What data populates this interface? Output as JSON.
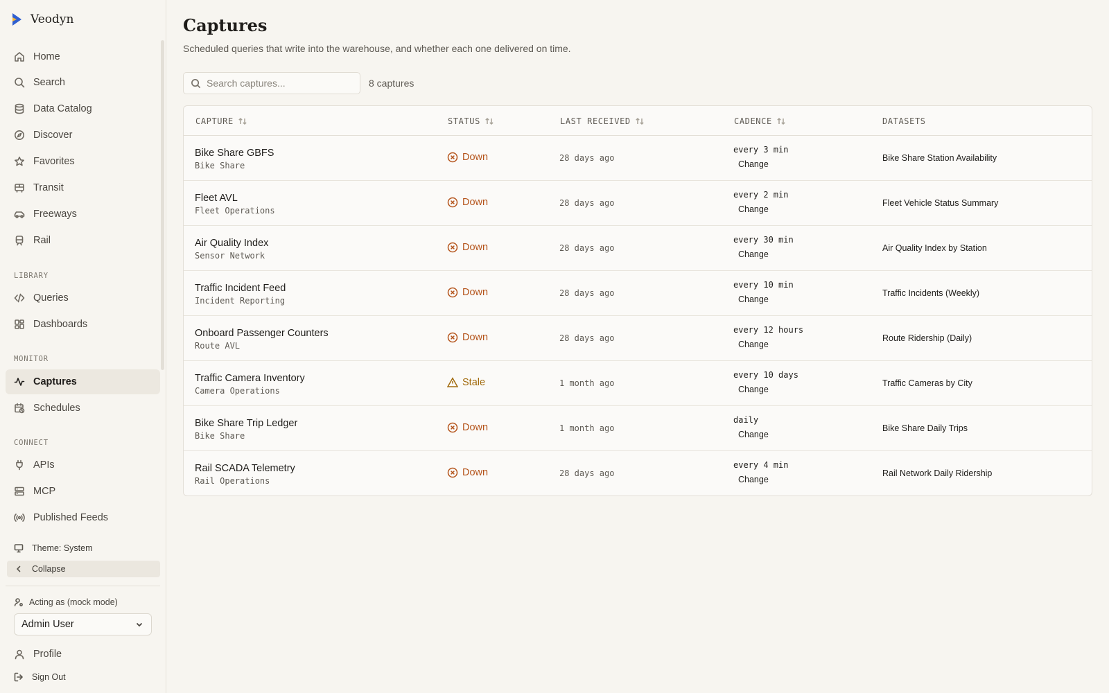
{
  "app": {
    "name": "Veodyn"
  },
  "colors": {
    "accent_blue": "#2f5fd0",
    "accent_yellow": "#f2b33a",
    "down": "#b4531a",
    "stale": "#a16a0c",
    "background": "#f7f5f0"
  },
  "sidebar": {
    "main_items": [
      {
        "label": "Home",
        "icon": "home-icon"
      },
      {
        "label": "Search",
        "icon": "search-icon"
      },
      {
        "label": "Data Catalog",
        "icon": "database-icon"
      },
      {
        "label": "Discover",
        "icon": "compass-icon"
      },
      {
        "label": "Favorites",
        "icon": "star-icon"
      },
      {
        "label": "Transit",
        "icon": "bus-icon"
      },
      {
        "label": "Freeways",
        "icon": "car-icon"
      },
      {
        "label": "Rail",
        "icon": "train-icon"
      }
    ],
    "library_label": "LIBRARY",
    "library_items": [
      {
        "label": "Queries",
        "icon": "code-icon"
      },
      {
        "label": "Dashboards",
        "icon": "dashboard-icon"
      }
    ],
    "monitor_label": "MONITOR",
    "monitor_items": [
      {
        "label": "Captures",
        "icon": "activity-icon",
        "active": true
      },
      {
        "label": "Schedules",
        "icon": "calendar-clock-icon"
      }
    ],
    "connect_label": "CONNECT",
    "connect_items": [
      {
        "label": "APIs",
        "icon": "plug-icon"
      },
      {
        "label": "MCP",
        "icon": "server-icon"
      },
      {
        "label": "Published Feeds",
        "icon": "broadcast-icon"
      }
    ],
    "theme_label": "Theme: System",
    "collapse_label": "Collapse",
    "acting_label": "Acting as (mock mode)",
    "acting_user": "Admin User",
    "profile_label": "Profile",
    "signout_label": "Sign Out"
  },
  "page": {
    "title": "Captures",
    "subtitle": "Scheduled queries that write into the warehouse, and whether each one delivered on time.",
    "search_placeholder": "Search captures...",
    "count_label": "8 captures"
  },
  "table": {
    "headers": [
      "CAPTURE",
      "STATUS",
      "LAST RECEIVED",
      "CADENCE",
      "DATASETS"
    ],
    "change_label": "Change",
    "rows": [
      {
        "name": "Bike Share GBFS",
        "owner": "Bike Share",
        "status": "Down",
        "status_type": "down",
        "last_received": "28 days ago",
        "cadence": "every 3 min",
        "dataset": "Bike Share Station Availability"
      },
      {
        "name": "Fleet AVL",
        "owner": "Fleet Operations",
        "status": "Down",
        "status_type": "down",
        "last_received": "28 days ago",
        "cadence": "every 2 min",
        "dataset": "Fleet Vehicle Status Summary"
      },
      {
        "name": "Air Quality Index",
        "owner": "Sensor Network",
        "status": "Down",
        "status_type": "down",
        "last_received": "28 days ago",
        "cadence": "every 30 min",
        "dataset": "Air Quality Index by Station"
      },
      {
        "name": "Traffic Incident Feed",
        "owner": "Incident Reporting",
        "status": "Down",
        "status_type": "down",
        "last_received": "28 days ago",
        "cadence": "every 10 min",
        "dataset": "Traffic Incidents (Weekly)"
      },
      {
        "name": "Onboard Passenger Counters",
        "owner": "Route AVL",
        "status": "Down",
        "status_type": "down",
        "last_received": "28 days ago",
        "cadence": "every 12 hours",
        "dataset": "Route Ridership (Daily)"
      },
      {
        "name": "Traffic Camera Inventory",
        "owner": "Camera Operations",
        "status": "Stale",
        "status_type": "stale",
        "last_received": "1 month ago",
        "cadence": "every 10 days",
        "dataset": "Traffic Cameras by City"
      },
      {
        "name": "Bike Share Trip Ledger",
        "owner": "Bike Share",
        "status": "Down",
        "status_type": "down",
        "last_received": "1 month ago",
        "cadence": "daily",
        "dataset": "Bike Share Daily Trips"
      },
      {
        "name": "Rail SCADA Telemetry",
        "owner": "Rail Operations",
        "status": "Down",
        "status_type": "down",
        "last_received": "28 days ago",
        "cadence": "every 4 min",
        "dataset": "Rail Network Daily Ridership"
      }
    ]
  }
}
